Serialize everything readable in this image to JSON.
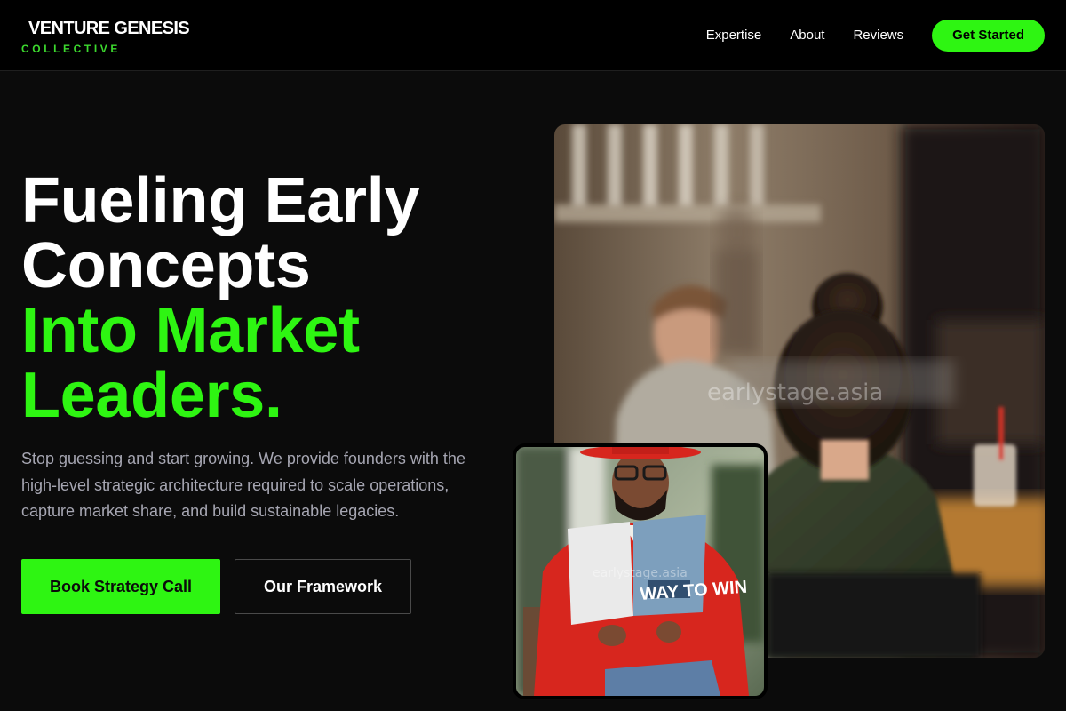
{
  "brand": {
    "name": "VENTURE GENESIS",
    "tagline": "COLLECTIVE"
  },
  "nav": {
    "links": [
      "Expertise",
      "About",
      "Reviews"
    ],
    "cta": "Get Started"
  },
  "hero": {
    "title_lines": [
      "Fueling Early",
      "Concepts"
    ],
    "title_accent_lines": [
      "Into Market",
      "Leaders."
    ],
    "description": "Stop guessing and start growing. We provide founders with the high-level strategic architecture required to scale operations, capture market share, and build sustainable legacies.",
    "primary_button": "Book Strategy Call",
    "secondary_button": "Our Framework"
  },
  "images": {
    "main": {
      "subject": "blurred-meeting-photo",
      "watermark": "earlystage.asia"
    },
    "inset": {
      "subject": "man-reading-book-photo",
      "watermark": "earlystage.asia",
      "book_title": "WAY TO WIN"
    }
  },
  "colors": {
    "accent": "#2ef512",
    "background": "#0b0b0b",
    "nav_background": "#000000",
    "muted_text": "#a6a6b2"
  }
}
